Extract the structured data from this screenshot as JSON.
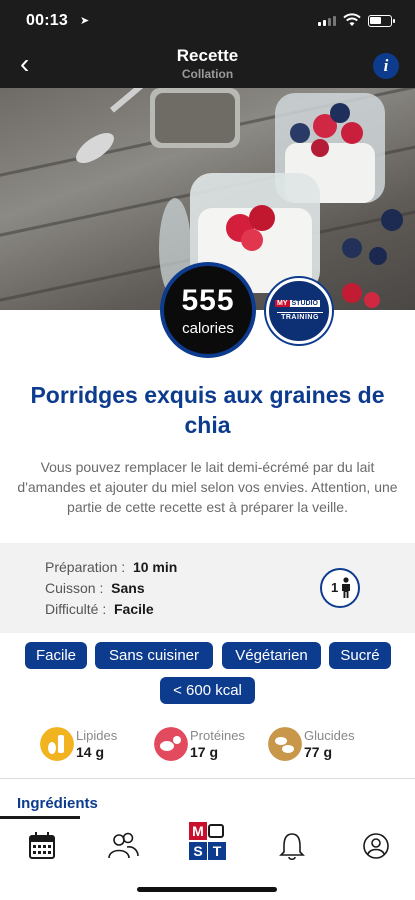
{
  "status_bar": {
    "time": "00:13"
  },
  "nav": {
    "title": "Recette",
    "subtitle": "Collation",
    "back_glyph": "‹",
    "info_glyph": "i"
  },
  "hero": {
    "calories_value": "555",
    "calories_label": "calories"
  },
  "brand": {
    "line1_a": "MY",
    "line1_b": "STUDIO",
    "line2": "TRAINING"
  },
  "recipe": {
    "title": "Porridges exquis aux graines de chia",
    "description": "Vous pouvez remplacer le lait demi-écrémé par du lait d'amandes et ajouter du miel selon vos envies. Attention, une partie de cette recette est à préparer la veille."
  },
  "details": {
    "prep_label": "Préparation :",
    "prep_value": "10 min",
    "cook_label": "Cuisson :",
    "cook_value": "Sans",
    "difficulty_label": "Difficulté :",
    "difficulty_value": "Facile",
    "servings": "1"
  },
  "tags": [
    "Facile",
    "Sans cuisiner",
    "Végétarien",
    "Sucré",
    "< 600 kcal"
  ],
  "macros": [
    {
      "label": "Lipides",
      "value": "14 g",
      "color": "#f2b321"
    },
    {
      "label": "Protéines",
      "value": "17 g",
      "color": "#e24b5e"
    },
    {
      "label": "Glucides",
      "value": "77 g",
      "color": "#c9974a"
    }
  ],
  "sections": {
    "ingredients": "Ingrédients"
  },
  "tabbar": {
    "logo_letters": [
      "M",
      "S",
      "T"
    ]
  },
  "colors": {
    "brand_blue": "#0d3b8e",
    "top_bar": "#1c1c1c"
  },
  "icons": [
    "location-arrow-icon",
    "signal-icon",
    "wifi-icon",
    "battery-icon",
    "back-chevron-icon",
    "info-icon",
    "person-icon",
    "calendar-icon",
    "people-icon",
    "bell-icon",
    "profile-icon"
  ]
}
